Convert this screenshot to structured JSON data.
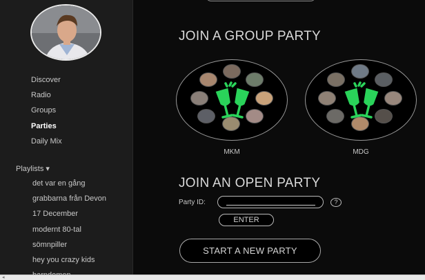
{
  "profile": {
    "avatar_icon": "user-avatar-photo"
  },
  "nav": {
    "items": [
      {
        "label": "Discover",
        "active": false
      },
      {
        "label": "Radio",
        "active": false
      },
      {
        "label": "Groups",
        "active": false
      },
      {
        "label": "Parties",
        "active": true
      },
      {
        "label": "Daily Mix",
        "active": false
      }
    ]
  },
  "playlists": {
    "header": "Playlists ▾",
    "items": [
      "det var en gång",
      "grabbarna från Devon",
      "17 December",
      "modernt 80-tal",
      "sömnpiller",
      "hey you crazy kids",
      "barndomen"
    ]
  },
  "main": {
    "group_heading": "JOIN A GROUP PARTY",
    "groups": [
      {
        "label": "MKM",
        "icon": "champagne-toast-icon"
      },
      {
        "label": "MDG",
        "icon": "champagne-toast-icon"
      }
    ],
    "open_heading": "JOIN AN OPEN PARTY",
    "party_id_label": "Party ID:",
    "party_id_value": "",
    "help_label": "?",
    "enter_label": "ENTER",
    "start_label": "START A NEW PARTY"
  },
  "colors": {
    "accent_green": "#2ad35a",
    "background": "#0b0b0b",
    "sidebar": "#1c1c1c"
  },
  "scrollbar": {
    "arrow": "◂"
  }
}
